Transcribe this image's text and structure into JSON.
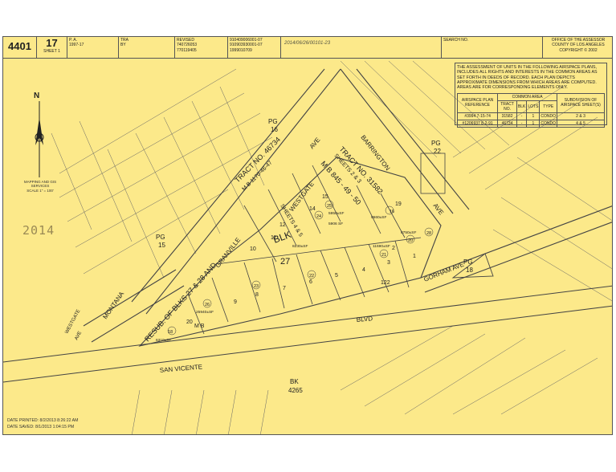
{
  "header": {
    "book": "4401",
    "page": "17",
    "sheet": "SHEET 1",
    "pa_label": "P. A.",
    "pa_value": "1997-17",
    "tra_label": "TRA",
    "tra_value": "BY",
    "revised_label": "REVISED",
    "revised_1": "740726053",
    "revised_2": "770119405",
    "revisions": [
      "910409006001-07",
      "910903930001-07",
      "1999010709"
    ],
    "handnote": "2014/06/26/00101-23",
    "search_label": "SEARCH NO.",
    "office": [
      "OFFICE OF THE ASSESSOR",
      "COUNTY OF LOS ANGELES",
      "COPYRIGHT © 2002"
    ]
  },
  "notice": {
    "text": "THE ASSESSMENT OF UNITS IN THE FOLLOWING AIRSPACE PLANS, INCLUDES ALL RIGHTS AND INTERESTS IN THE COMMON AREAS AS SET FORTH IN DEEDS OF RECORD. EACH PLAN DEPICTS APPROXIMATE DIMENSIONS FROM WHICH AREAS ARE COMPUTED. AREAS ARE FOR CORRESPONDING ELEMENTS ONLY.",
    "col_airspace": "AIRSPACE PLAN REFERENCE",
    "col_common": "COMMON AREA",
    "col_subdiv": "SUBDIVISION OF AIRSPACE SHEET(S)",
    "sub_cols": [
      "TRACT NO.",
      "BLK",
      "LOTS",
      "TYPE"
    ],
    "rows": [
      [
        "#3994  7-15-74",
        "31582",
        "-",
        "1",
        "CONDO",
        "2 & 3"
      ],
      [
        "#1206937  8-2-91",
        "46734",
        "-",
        "1",
        "CONDO",
        "4 & 5"
      ]
    ]
  },
  "legend": {
    "north": "N",
    "lines": [
      "MAPPING AND GIS",
      "SERVICES",
      "SCALE 1\" = 100'"
    ]
  },
  "stamp": "2014",
  "streets": {
    "montana": "MONTANA",
    "westgate": "WESTGATE",
    "westgate_ave": "AVE",
    "san_vicente": "SAN VICENTE",
    "blvd": "BLVD",
    "barrington": "BARRINGTON",
    "barrington_ave": "AVE",
    "gorham": "GORHAM AVE",
    "granville": "GRANVILLE",
    "westgate2": "WESTGATE",
    "ave_top": "AVE"
  },
  "tract_labels": {
    "tract1": "TRACT NO. 46734",
    "tract1b": "M B 1170-46-47",
    "tract2": "TRACT NO. 31582",
    "tract2b": "SHEETS 2 & 3",
    "mb": "M B 845 - 49 - 50",
    "resub": "RESUB. OF BLKS 27 & 28  AND",
    "sheets45": "SHEETS 4 & 5",
    "blk": "BLK",
    "blk27": "27",
    "mb2": "M B",
    "bk": "BK",
    "bk_num": "4265"
  },
  "pg_labels": [
    {
      "pg": "PG",
      "num": "16"
    },
    {
      "pg": "PG",
      "num": "15"
    },
    {
      "pg": "PG",
      "num": "22"
    },
    {
      "pg": "PG",
      "num": "18"
    }
  ],
  "lots": [
    "1",
    "2",
    "3",
    "4",
    "5",
    "6",
    "7",
    "8",
    "9",
    "10",
    "11",
    "12",
    "14",
    "15",
    "19",
    "20",
    "122"
  ],
  "parcels": [
    "16",
    "18",
    "20",
    "21",
    "22",
    "23",
    "24",
    "25",
    "26",
    "28",
    "5",
    "7",
    "1",
    "8"
  ],
  "areas": [
    "25940±SF",
    "8230±SF",
    "5906 SF",
    "5950±SF",
    "11690±SF",
    "8750±SF",
    "6310±SF",
    "9560±SF"
  ],
  "footer": {
    "printed": "DATE PRINTED: 8/2/2013 8:26:22 AM",
    "saved": "DATE SAVED: 8/1/2013 1:04:15 PM"
  }
}
